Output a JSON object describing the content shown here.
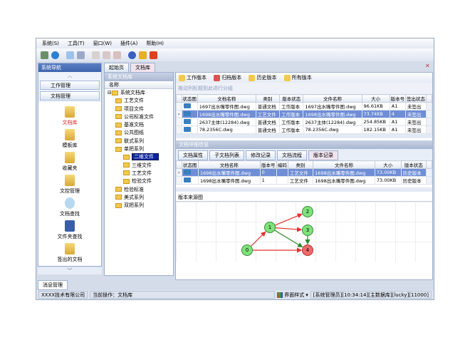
{
  "menu": [
    "系统(S)",
    "工具(T)",
    "窗口(W)",
    "插件(A)",
    "帮助(H)"
  ],
  "toolbar_icons": [
    "connect-icon",
    "globe-icon",
    "window-icon",
    "layout-icon",
    "doc-red-icon",
    "doc-add-icon",
    "doc-remove-icon",
    "help-icon",
    "lock-icon",
    "power-icon"
  ],
  "nav": {
    "title": "系统导航",
    "groups": [
      "工作管理",
      "文档管理"
    ],
    "items": [
      "文档库",
      "模板库",
      "收藏夹",
      "文控管理",
      "文档查找",
      "文件夹查找",
      "签出的文档"
    ],
    "bottom_tab": "消息管理"
  },
  "tabs": [
    "起始页",
    "文档库"
  ],
  "tree": {
    "title": "系统文档库",
    "header": "名称",
    "root": "系统文档库",
    "nodes": [
      {
        "label": "工艺文件",
        "level": 1
      },
      {
        "label": "项目文件",
        "level": 1
      },
      {
        "label": "公司标准文件",
        "level": 1
      },
      {
        "label": "基准文档",
        "level": 1
      },
      {
        "label": "公共图纸",
        "level": 1
      },
      {
        "label": "联式系列",
        "level": 1
      },
      {
        "label": "单把系列",
        "level": 1
      },
      {
        "label": "二维文件",
        "level": 2,
        "selected": true
      },
      {
        "label": "三维文件",
        "level": 2
      },
      {
        "label": "工艺文件",
        "level": 2
      },
      {
        "label": "检验文件",
        "level": 2
      },
      {
        "label": "检验标准",
        "level": 1
      },
      {
        "label": "美式系列",
        "level": 1
      },
      {
        "label": "双把系列",
        "level": 1
      }
    ]
  },
  "version_buttons": [
    "工作版本",
    "归档版本",
    "历史版本",
    "所有版本"
  ],
  "group_hint": "拖动列标题到此进行分组",
  "doc_table": {
    "columns": [
      "状态图",
      "文档名称",
      "类别",
      "版本状态",
      "文件名称",
      "大小",
      "版本号",
      "签出状态"
    ],
    "rows": [
      [
        "",
        "1697出水嘴零件图.dwg",
        "普通文档",
        "工作版本",
        "1697出水嘴零件图.dwg",
        "96.61KB",
        "A1",
        "未签出"
      ],
      [
        "",
        "1698出水嘴零件图.dwg",
        "工艺文件",
        "工作版本",
        "1698出水嘴零件图.dwg",
        "73.74KB",
        "4",
        "未签出"
      ],
      [
        "",
        "2637主体(12284).dwg",
        "普通文档",
        "工作版本",
        "2637主体(12284).dwg",
        "254.85KB",
        "A1",
        "未签出"
      ],
      [
        "",
        "78.2356C.dwg",
        "普通文档",
        "工作版本",
        "78.2356C.dwg",
        "182.15KB",
        "A1",
        "未签出"
      ]
    ],
    "selected": 1
  },
  "detail": {
    "title": "文档详细信息",
    "tabs": [
      "文档属性",
      "子文档列表",
      "修改记录",
      "文档流程",
      "版本记录"
    ],
    "active_tab": 4,
    "columns": [
      "状态图",
      "文档名称",
      "版本号",
      "编码",
      "类别",
      "文件名称",
      "大小",
      "版本状态"
    ],
    "rows": [
      [
        "",
        "1698出水嘴零件图.dwg",
        "0",
        "",
        "工艺文件",
        "1698出水嘴零件图.dwg",
        "73.00KB",
        "历史版本"
      ],
      [
        "",
        "1698出水嘴零件图.dwg",
        "1",
        "",
        "工艺文件",
        "1698出水嘴零件图.dwg",
        "73.00KB",
        "历史版本"
      ]
    ]
  },
  "graph": {
    "title": "版本来源图",
    "nodes": [
      "0",
      "1",
      "2",
      "3",
      "4"
    ],
    "current": "4",
    "edges": [
      {
        "from": "0",
        "to": "1",
        "color": "#e83030"
      },
      {
        "from": "1",
        "to": "2",
        "color": "#e83030"
      },
      {
        "from": "1",
        "to": "3",
        "color": "#e83030"
      },
      {
        "from": "0",
        "to": "4",
        "color": "#e83030"
      },
      {
        "from": "1",
        "to": "4",
        "color": "#2a8a2a"
      },
      {
        "from": "3",
        "to": "4",
        "color": "#2a8a2a"
      }
    ]
  },
  "status": {
    "company": "XXXX技术有限公司",
    "operation": "当前操作：文档库",
    "style": "界面样式",
    "info": "[系统管理员][10:34:14][主数据库][lucky][11000]"
  }
}
